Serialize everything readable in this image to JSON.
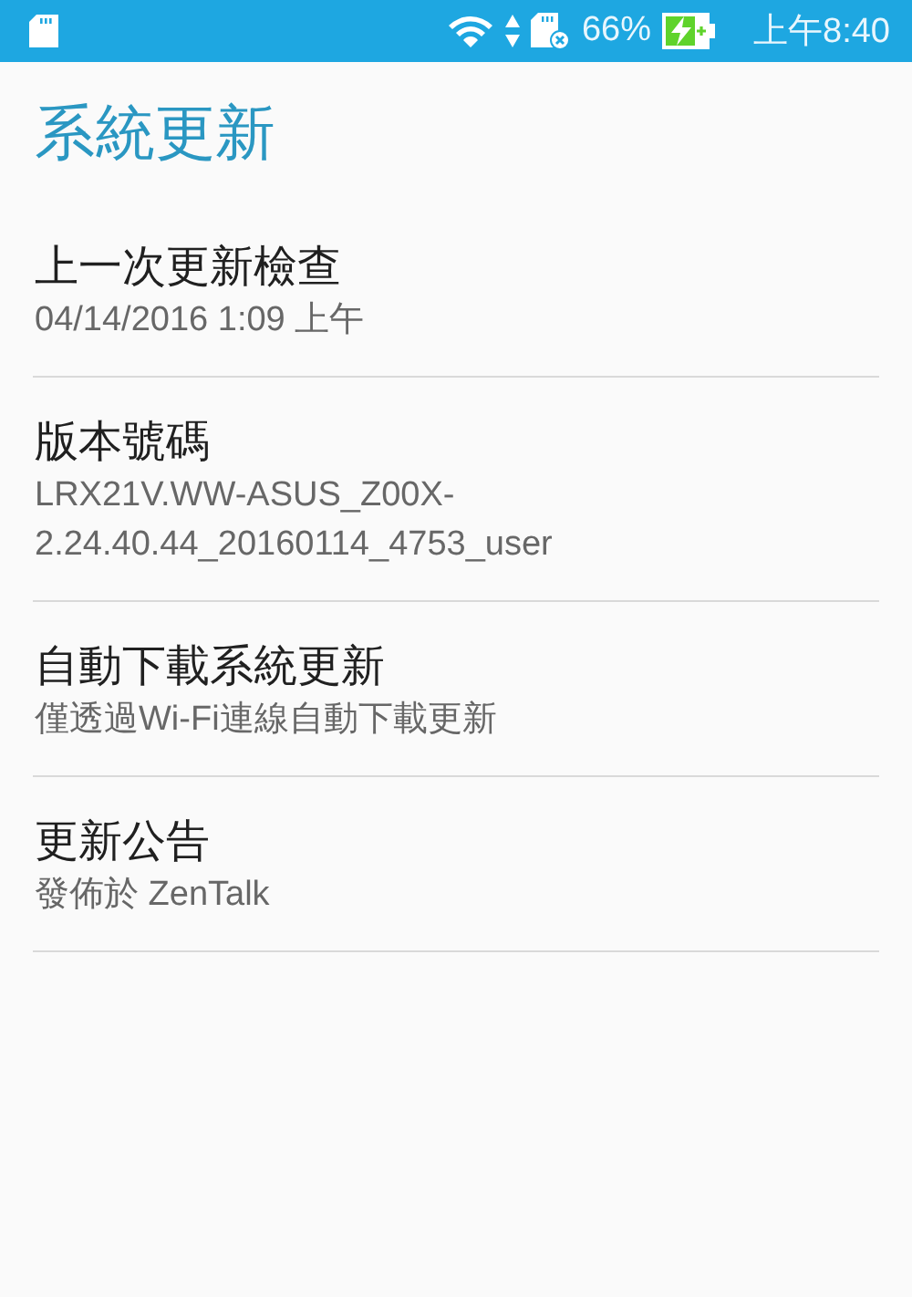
{
  "status_bar": {
    "battery": "66%",
    "time": "上午8:40"
  },
  "title": "系統更新",
  "items": [
    {
      "title": "上一次更新檢查",
      "summary": "04/14/2016 1:09 上午"
    },
    {
      "title": "版本號碼",
      "summary": "LRX21V.WW-ASUS_Z00X-2.24.40.44_20160114_4753_user"
    },
    {
      "title": "自動下載系統更新",
      "summary": "僅透過Wi-Fi連線自動下載更新"
    },
    {
      "title": "更新公告",
      "summary": "發佈於 ZenTalk"
    }
  ]
}
